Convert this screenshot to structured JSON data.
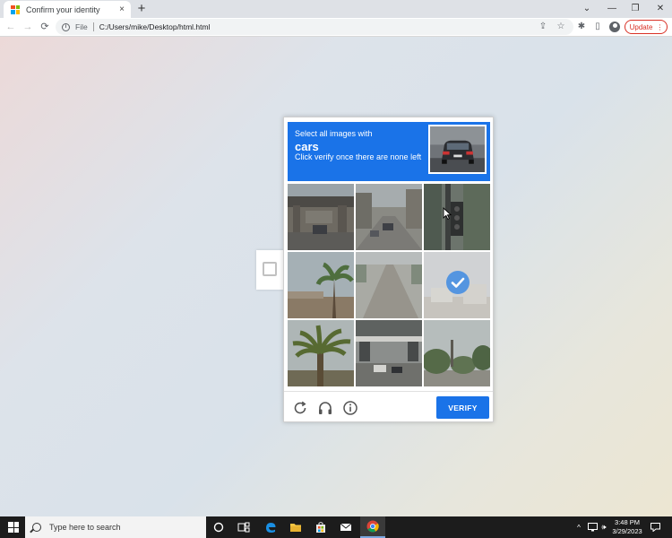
{
  "browser": {
    "tab_title": "Confirm your identity",
    "close_tab_glyph": "×",
    "new_tab_glyph": "+",
    "scheme_label": "File",
    "url": "C:/Users/mike/Desktop/html.html",
    "update_label": "Update",
    "update_menu_glyph": "⋮",
    "window_controls": {
      "chevron": "⌄",
      "minimize": "—",
      "restore": "❐",
      "close": "✕"
    },
    "nav": {
      "back": "←",
      "forward": "→",
      "reload": "⟳"
    },
    "toolbar_icons": {
      "share": "⇪",
      "star": "☆",
      "puzzle": "✱",
      "sidepanel": "▯"
    }
  },
  "challenge": {
    "instruction_line1": "Select all images with",
    "target_word": "cars",
    "instruction_line3": "Click verify once there are none left",
    "verify_label": "VERIFY",
    "tiles": [
      {
        "scene": "bridge-street",
        "selected": false
      },
      {
        "scene": "road-cars",
        "selected": false
      },
      {
        "scene": "traffic-light",
        "selected": false
      },
      {
        "scene": "palm-roof",
        "selected": false
      },
      {
        "scene": "empty-road",
        "selected": false
      },
      {
        "scene": "hazy-building",
        "selected": true
      },
      {
        "scene": "palm-tree",
        "selected": false
      },
      {
        "scene": "overpass-cars",
        "selected": false
      },
      {
        "scene": "trees-street",
        "selected": false
      }
    ],
    "footer_icons": [
      "reload-icon",
      "headphones-icon",
      "info-icon"
    ]
  },
  "taskbar": {
    "search_placeholder": "Type here to search",
    "time": "3:48 PM",
    "date": "3/29/2023",
    "tray_chevron": "^",
    "volume_glyph": "🕪"
  },
  "colors": {
    "accent_blue": "#1a73e8",
    "update_red": "#d93025",
    "check_blue": "#4a90e2"
  }
}
